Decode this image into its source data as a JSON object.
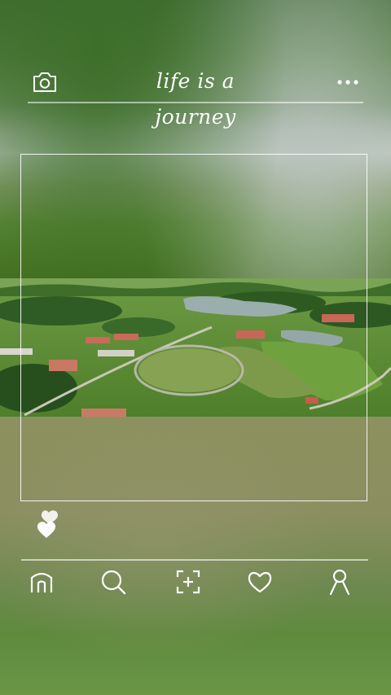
{
  "header": {
    "title": "life is a journey",
    "left_icon": "camera-icon",
    "right_icon": "more-dots-icon"
  },
  "post": {
    "photo_description_icon": "aerial-landscape-photo",
    "like_icon": "heart-sticker-icon"
  },
  "bottom_nav": {
    "items": [
      {
        "icon": "home-icon"
      },
      {
        "icon": "search-icon"
      },
      {
        "icon": "add-post-icon"
      },
      {
        "icon": "heart-icon"
      },
      {
        "icon": "profile-icon"
      }
    ]
  },
  "colors": {
    "accent": "#ffffff",
    "grass": "#5f8a37",
    "roof": "#c96a5a"
  }
}
